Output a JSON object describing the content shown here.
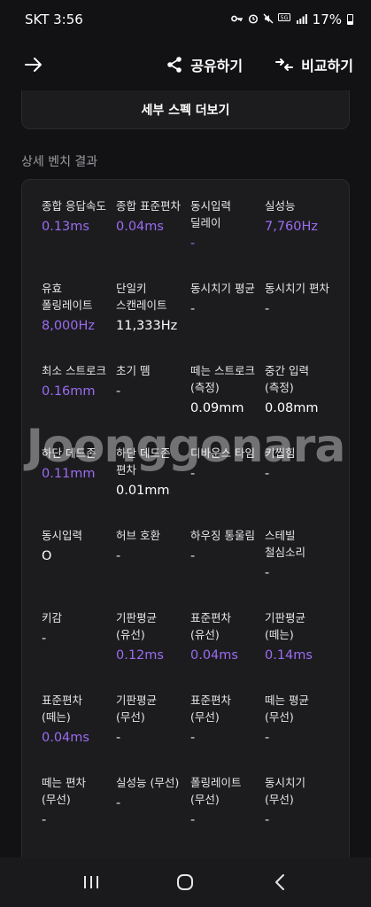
{
  "status": {
    "carrier_time": "SKT 3:56",
    "battery": "17%",
    "network_badge": "5G"
  },
  "header": {
    "share_label": "공유하기",
    "compare_label": "비교하기"
  },
  "more_spec_label": "세부 스펙 더보기",
  "section_title": "상세 벤치 결과",
  "watermark": "Joonggonara",
  "accent_color": "#9b6cf0",
  "bench": [
    {
      "label": "종합 응답속도",
      "value": "0.13ms",
      "accent": true
    },
    {
      "label": "종합 표준편차",
      "value": "0.04ms",
      "accent": true
    },
    {
      "label": "동시입력 딜레이",
      "value": "-",
      "accent": true
    },
    {
      "label": "실성능",
      "value": "7,760Hz",
      "accent": true
    },
    {
      "label": "유효 폴링레이트",
      "value": "8,000Hz",
      "accent": true
    },
    {
      "label": "단일키 스캔레이트",
      "value": "11,333Hz",
      "accent": false
    },
    {
      "label": "동시치기 평균",
      "value": "-",
      "accent": false
    },
    {
      "label": "동시치기 편차",
      "value": "-",
      "accent": false
    },
    {
      "label": "최소 스트로크",
      "value": "0.16mm",
      "accent": true
    },
    {
      "label": "초기 뗌",
      "value": "-",
      "accent": false
    },
    {
      "label": "떼는 스트로크 (측정)",
      "value": "0.09mm",
      "accent": false
    },
    {
      "label": "중간 입력 (측정)",
      "value": "0.08mm",
      "accent": false
    },
    {
      "label": "하단 데드존",
      "value": "0.11mm",
      "accent": true
    },
    {
      "label": "하단 데드존 편차",
      "value": "0.01mm",
      "accent": false
    },
    {
      "label": "디바운스 타임",
      "value": "-",
      "accent": false
    },
    {
      "label": "키씹힘",
      "value": "-",
      "accent": false
    },
    {
      "label": "동시입력",
      "value": "O",
      "accent": false
    },
    {
      "label": "허브 호환",
      "value": "-",
      "accent": false
    },
    {
      "label": "하우징 통울림",
      "value": "-",
      "accent": false
    },
    {
      "label": "스테빌 철심소리",
      "value": "-",
      "accent": false
    },
    {
      "label": "키감",
      "value": "-",
      "accent": false
    },
    {
      "label": "기판평균 (유선)",
      "value": "0.12ms",
      "accent": true
    },
    {
      "label": "표준편차 (유선)",
      "value": "0.04ms",
      "accent": true
    },
    {
      "label": "기판평균 (떼는)",
      "value": "0.14ms",
      "accent": true
    },
    {
      "label": "표준편차 (떼는)",
      "value": "0.04ms",
      "accent": true
    },
    {
      "label": "기판평균 (무선)",
      "value": "-",
      "accent": false
    },
    {
      "label": "표준편차 (무선)",
      "value": "-",
      "accent": false
    },
    {
      "label": "떼는 평균 (무선)",
      "value": "-",
      "accent": false
    },
    {
      "label": "떼는 편차 (무선)",
      "value": "-",
      "accent": false
    },
    {
      "label": "실성능 (무선)",
      "value": "-",
      "accent": false
    },
    {
      "label": "폴링레이트 (무선)",
      "value": "-",
      "accent": false
    },
    {
      "label": "동시치기 (무선)",
      "value": "-",
      "accent": false
    }
  ]
}
